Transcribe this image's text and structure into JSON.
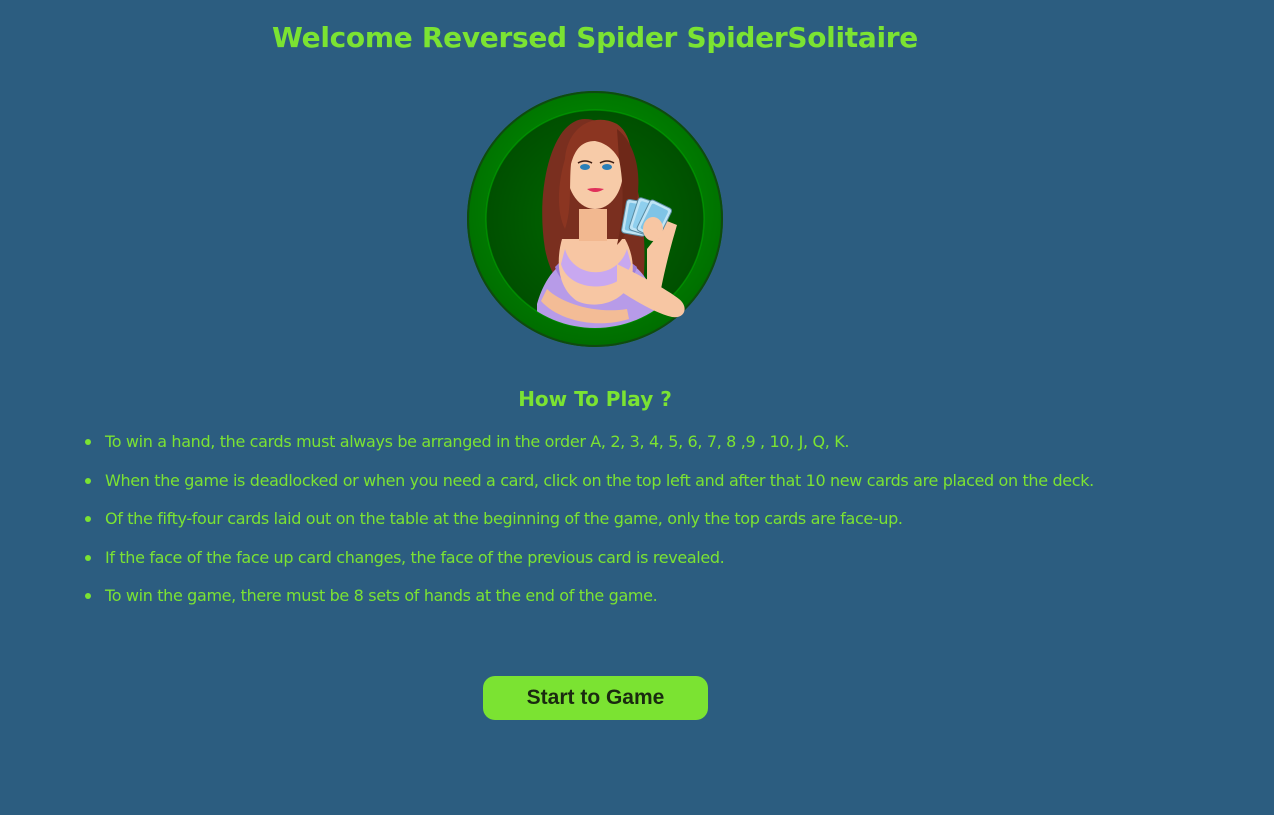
{
  "header": {
    "title": "Welcome Reversed Spider SpiderSolitaire"
  },
  "avatar": {
    "icon": "card-dealer-girl-icon",
    "ring_color": "#008a00",
    "inner_color": "#005c00"
  },
  "instructions": {
    "heading": "How To Play ?",
    "rules": [
      "To win a hand, the cards must always be arranged in the order A, 2, 3, 4, 5, 6, 7, 8 ,9 , 10, J, Q, K.",
      "When the game is deadlocked or when you need a card, click on the top left and after that 10 new cards are placed on the deck.",
      "Of the fifty-four cards laid out on the table at the beginning of the game, only the top cards are face-up.",
      "If the face of the face up card changes, the face of the previous card is revealed.",
      "To win the game, there must be 8 sets of hands at the end of the game."
    ]
  },
  "actions": {
    "start_label": "Start to Game"
  },
  "colors": {
    "background": "#2c5d80",
    "accent": "#7be332"
  }
}
